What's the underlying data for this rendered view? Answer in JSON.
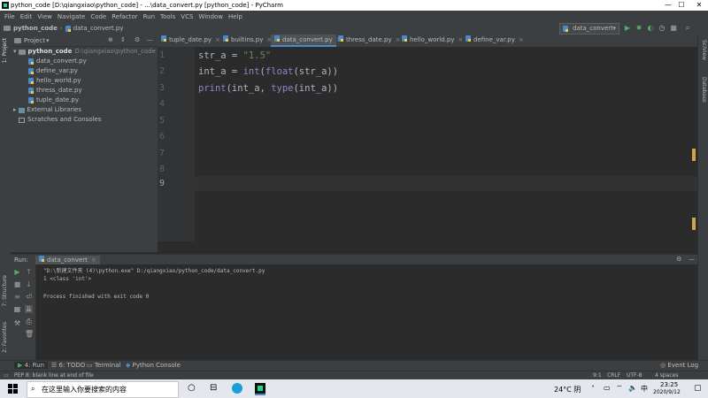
{
  "window": {
    "title": "python_code [D:\\qiangxiao\\python_code] - ...\\data_convert.py [python_code] - PyCharm",
    "minimize": "—",
    "maximize": "☐",
    "close": "✕"
  },
  "menu": [
    "File",
    "Edit",
    "View",
    "Navigate",
    "Code",
    "Refactor",
    "Run",
    "Tools",
    "VCS",
    "Window",
    "Help"
  ],
  "navbar": {
    "project": "python_code",
    "file": "data_convert.py",
    "run_config": "data_convert"
  },
  "project_panel": {
    "title": "Project",
    "root_name": "python_code",
    "root_path": "D:\\qiangxiao\\python_code",
    "files": [
      "data_convert.py",
      "define_var.py",
      "hello_world.py",
      "thress_date.py",
      "tuple_date.py"
    ],
    "external": "External Libraries",
    "scratches": "Scratches and Consoles"
  },
  "tabs": [
    "tuple_date.py",
    "builtins.py",
    "data_convert.py",
    "thress_date.py",
    "hello_world.py",
    "define_var.py"
  ],
  "editor": {
    "line_numbers": [
      "1",
      "2",
      "3",
      "4",
      "5",
      "6",
      "7",
      "8",
      "9"
    ],
    "line1": {
      "a": "str_a = ",
      "b": "\"1.5\""
    },
    "line2": {
      "a": "int_a = ",
      "b": "int",
      "c": "(",
      "d": "float",
      "e": "(str_a))"
    },
    "line3": {
      "a": "print",
      "b": "(int_a, ",
      "c": "type",
      "d": "(int_a))"
    }
  },
  "run_panel": {
    "label": "Run:",
    "tab": "data_convert",
    "lines": [
      "\"D:\\新建文件夹 (4)\\python.exe\" D:/qiangxiao/python_code/data_convert.py",
      "1 <class 'int'>",
      "",
      "Process finished with exit code 0"
    ]
  },
  "left_strip": {
    "project": "1: Project",
    "structure": "7: Structure",
    "favorites": "2: Favorites"
  },
  "right_strip": {
    "scview": "SciView",
    "database": "Database"
  },
  "bottom_tabs": [
    "4: Run",
    "6: TODO",
    "Terminal",
    "Python Console"
  ],
  "event_log": "Event Log",
  "status": {
    "message": "PEP 8: blank line at end of file",
    "position": "9:1",
    "line_sep": "CRLF",
    "encoding": "UTF-8",
    "indent": "4 spaces"
  },
  "taskbar": {
    "search_placeholder": "在这里输入你要搜索的内容",
    "weather": "24°C 阴",
    "time": "23:25",
    "date": "2020/9/12"
  }
}
